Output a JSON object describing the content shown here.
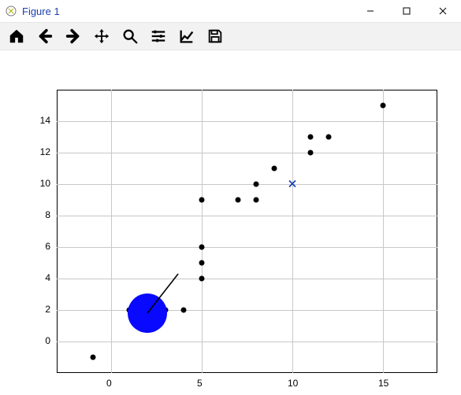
{
  "window": {
    "title": "Figure 1"
  },
  "toolbar": {
    "items": [
      {
        "name": "home-icon",
        "interactable": true
      },
      {
        "name": "back-icon",
        "interactable": true
      },
      {
        "name": "forward-icon",
        "interactable": true
      },
      {
        "name": "move-icon",
        "interactable": true
      },
      {
        "name": "zoom-icon",
        "interactable": true
      },
      {
        "name": "config-icon",
        "interactable": true
      },
      {
        "name": "axes-icon",
        "interactable": true
      },
      {
        "name": "save-icon",
        "interactable": true
      }
    ]
  },
  "chart_data": {
    "type": "scatter",
    "x_ticks": [
      0,
      5,
      10,
      15
    ],
    "y_ticks": [
      0,
      2,
      4,
      6,
      8,
      10,
      12,
      14
    ],
    "xlim": [
      -3,
      18
    ],
    "ylim": [
      -2,
      16
    ],
    "series": [
      {
        "name": "black-dots",
        "marker": "circle",
        "color": "#000000",
        "size": 7,
        "points": [
          {
            "x": -1,
            "y": -1
          },
          {
            "x": 1,
            "y": 2
          },
          {
            "x": 3,
            "y": 2
          },
          {
            "x": 4,
            "y": 2
          },
          {
            "x": 5,
            "y": 4
          },
          {
            "x": 5,
            "y": 5
          },
          {
            "x": 5,
            "y": 6
          },
          {
            "x": 5,
            "y": 9
          },
          {
            "x": 7,
            "y": 9
          },
          {
            "x": 8,
            "y": 9
          },
          {
            "x": 8,
            "y": 10
          },
          {
            "x": 9,
            "y": 11
          },
          {
            "x": 11,
            "y": 12
          },
          {
            "x": 11,
            "y": 13
          },
          {
            "x": 12,
            "y": 13
          },
          {
            "x": 15,
            "y": 15
          }
        ]
      },
      {
        "name": "blue-x",
        "marker": "x",
        "color": "#1a3fb0",
        "size": 8,
        "points": [
          {
            "x": 10,
            "y": 10
          }
        ]
      },
      {
        "name": "blue-disc",
        "marker": "circle",
        "color": "#0909ff",
        "size": 50,
        "points": [
          {
            "x": 2,
            "y": 1.8
          }
        ]
      }
    ],
    "annotations": [
      {
        "type": "line",
        "from": {
          "x": 2,
          "y": 1.8
        },
        "to": {
          "x": 3.7,
          "y": 4.3
        },
        "color": "#000000",
        "width": 1.6
      }
    ]
  }
}
